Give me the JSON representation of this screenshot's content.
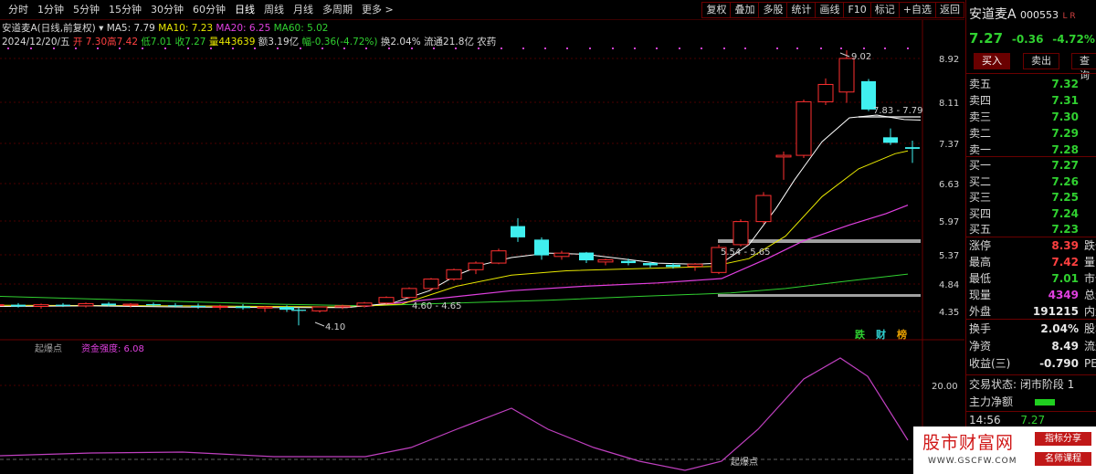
{
  "toolbar": {
    "periods": [
      "分时",
      "1分钟",
      "5分钟",
      "15分钟",
      "30分钟",
      "60分钟",
      "日线",
      "周线",
      "月线",
      "多周期",
      "更多 >"
    ],
    "right_buttons": [
      "复权",
      "叠加",
      "多股",
      "统计",
      "画线",
      "F10",
      "标记",
      "+自选",
      "返回"
    ]
  },
  "info": {
    "name": "安道麦A(日线,前复权)",
    "ma5": "MA5: 7.79",
    "ma10": "MA10: 7.23",
    "ma20": "MA20: 6.25",
    "ma60": "MA60: 5.02",
    "date": "2024/12/20/五",
    "open": "开 7.30",
    "high": "高7.42",
    "low": "低7.01",
    "close": "收7.27",
    "volume": "量443639",
    "amount": "额3.19亿",
    "change": "幅-0.36(-4.72%)",
    "turnover": "换2.04%",
    "float": "流通21.8亿",
    "sector": "农药"
  },
  "chart_data": {
    "type": "candlestick",
    "y_ticks": [
      "8.92",
      "8.11",
      "7.37",
      "6.63",
      "5.97",
      "5.37",
      "4.84",
      "4.35"
    ],
    "annotations": {
      "high": "9.02",
      "low": "4.10",
      "resistance": "7.83 - 7.79",
      "mid": "5.54 - 5.65",
      "base": "4.60 - 4.65"
    },
    "indicator": {
      "name": "起爆点",
      "label": "资金强度: 6.08",
      "y_tick": "20.00",
      "marker": "起爆点"
    },
    "badges": [
      "跌",
      "财",
      "榜"
    ],
    "colors": {
      "up": "#ff3030",
      "down": "#40f0f0",
      "ma5": "#ffffff",
      "ma10": "#e8e800",
      "ma20": "#e040e0",
      "ma60": "#30d030"
    }
  },
  "panel": {
    "stock": "安道麦A",
    "code": "000553",
    "lr": "L R",
    "price": "7.27",
    "change": "-0.36",
    "change_pct": "-4.72%",
    "buy_label": "买入",
    "sell_label": "卖出",
    "query_label": "查询",
    "asks": [
      {
        "label": "卖五",
        "price": "7.32"
      },
      {
        "label": "卖四",
        "price": "7.31"
      },
      {
        "label": "卖三",
        "price": "7.30"
      },
      {
        "label": "卖二",
        "price": "7.29"
      },
      {
        "label": "卖一",
        "price": "7.28"
      }
    ],
    "bids": [
      {
        "label": "买一",
        "price": "7.27"
      },
      {
        "label": "买二",
        "price": "7.26"
      },
      {
        "label": "买三",
        "price": "7.25"
      },
      {
        "label": "买四",
        "price": "7.24"
      },
      {
        "label": "买五",
        "price": "7.23"
      }
    ],
    "stats": [
      {
        "label": "涨停",
        "value": "8.39",
        "label2": "跌停"
      },
      {
        "label": "最高",
        "value": "7.42",
        "label2": "量比"
      },
      {
        "label": "最低",
        "value": "7.01",
        "label2": "市值"
      },
      {
        "label": "现量",
        "value": "4349",
        "label2": "总量"
      },
      {
        "label": "外盘",
        "value": "191215",
        "label2": "内盘"
      }
    ],
    "stats2": [
      {
        "label": "换手",
        "value": "2.04%",
        "label2": "股本"
      },
      {
        "label": "净资",
        "value": "8.49",
        "label2": "流通"
      },
      {
        "label": "收益(三)",
        "value": "-0.790",
        "label2": "PE(动"
      }
    ],
    "trade_status": "交易状态: 闭市阶段 1",
    "main_net": "主力净额",
    "time": "14:56",
    "time_price": "7.27"
  },
  "watermark": {
    "title": "股市财富网",
    "url": "WWW.GSCFW.COM",
    "tag1": "指标分享",
    "tag2": "名师课程"
  }
}
